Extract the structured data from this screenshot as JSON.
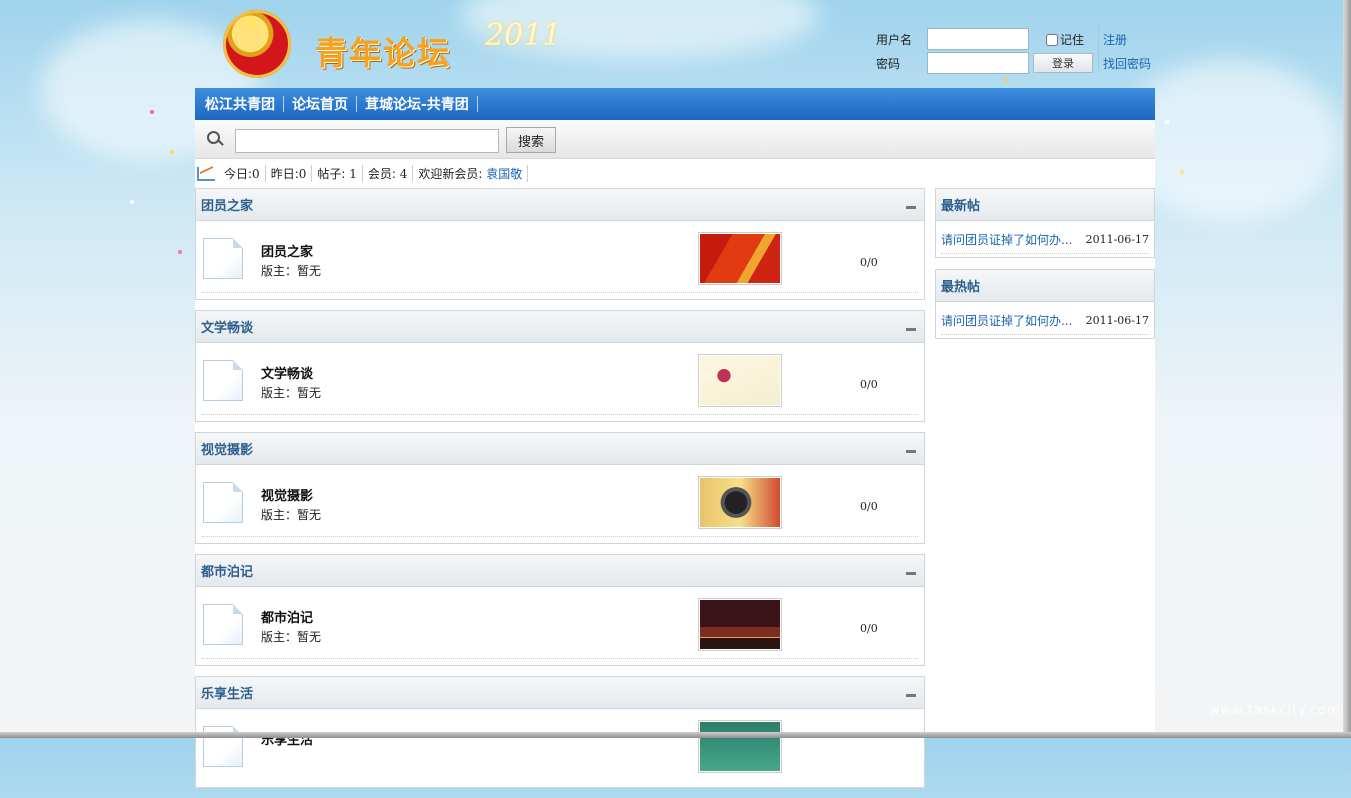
{
  "header": {
    "site_title": "青年论坛",
    "year": "2011",
    "emblem_text": "中国共产主义青年团"
  },
  "login": {
    "username_label": "用户名",
    "password_label": "密码",
    "remember_label": "记住",
    "login_button": "登录",
    "register_link": "注册",
    "forgot_link": "找回密码"
  },
  "nav": {
    "items": [
      "松江共青团",
      "论坛首页",
      "茸城论坛-共青团"
    ]
  },
  "search": {
    "button": "搜索",
    "value": ""
  },
  "stats": {
    "today_label": "今日:",
    "today": "0",
    "yesterday_label": "昨日:",
    "yesterday": "0",
    "posts_label": "帖子:",
    "posts": "1",
    "members_label": "会员:",
    "members": "4",
    "new_member_label": "欢迎新会员:",
    "new_member": "袁国敬"
  },
  "forums": [
    {
      "title": "团员之家",
      "name": "团员之家",
      "moderator": "版主：暂无",
      "counts": "0/0",
      "thumb": "party-flag"
    },
    {
      "title": "文学畅谈",
      "name": "文学畅谈",
      "moderator": "版主：暂无",
      "counts": "0/0",
      "thumb": "magnolia"
    },
    {
      "title": "视觉摄影",
      "name": "视觉摄影",
      "moderator": "版主：暂无",
      "counts": "0/0",
      "thumb": "camera"
    },
    {
      "title": "都市泊记",
      "name": "都市泊记",
      "moderator": "版主：暂无",
      "counts": "0/0",
      "thumb": "city-night"
    },
    {
      "title": "乐享生活",
      "name": "乐享生活",
      "moderator": "",
      "counts": "",
      "thumb": "leisure"
    }
  ],
  "sidebar": {
    "latest": {
      "title": "最新帖",
      "posts": [
        {
          "title": "请问团员证掉了如何办...",
          "date": "2011-06-17"
        }
      ]
    },
    "hot": {
      "title": "最热帖",
      "posts": [
        {
          "title": "请问团员证掉了如何办...",
          "date": "2011-06-17"
        }
      ]
    }
  },
  "watermark": "www.taskcity.com"
}
